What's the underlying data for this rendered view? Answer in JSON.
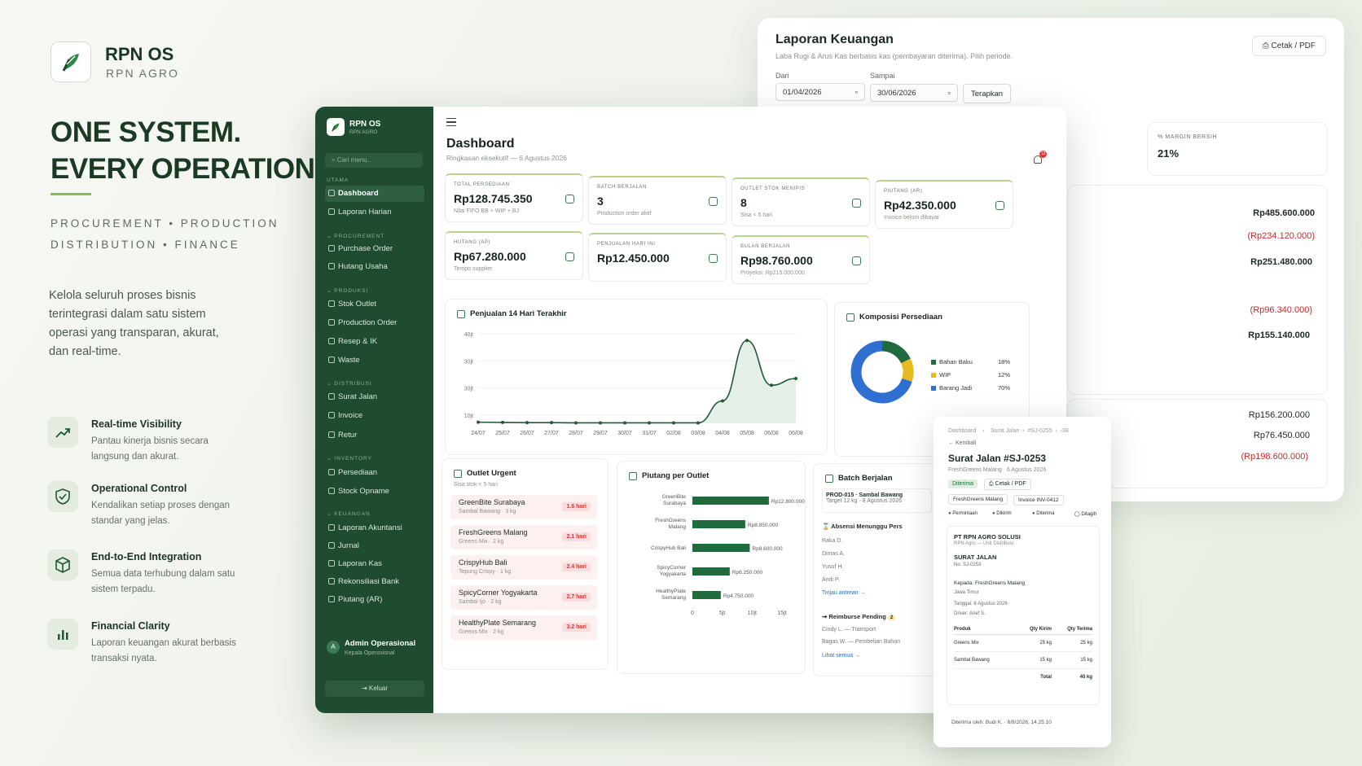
{
  "brand": {
    "name": "RPN OS",
    "sub": "RPN AGRO"
  },
  "hero": {
    "line1": "ONE SYSTEM.",
    "line2": "EVERY OPERATION.",
    "tag1": "PROCUREMENT • PRODUCTION",
    "tag2": "DISTRIBUTION • FINANCE",
    "desc": "Kelola seluruh proses bisnis terintegrasi dalam satu sistem operasi yang transparan, akurat, dan real-time."
  },
  "features": [
    {
      "icon": "trend-up-icon",
      "title": "Real-time Visibility",
      "desc": "Pantau kinerja bisnis secara langsung dan akurat."
    },
    {
      "icon": "shield-check-icon",
      "title": "Operational Control",
      "desc": "Kendalikan setiap proses dengan standar yang jelas."
    },
    {
      "icon": "cube-icon",
      "title": "End-to-End Integration",
      "desc": "Semua data terhubung dalam satu sistem terpadu."
    },
    {
      "icon": "bar-chart-icon",
      "title": "Financial Clarity",
      "desc": "Laporan keuangan akurat berbasis transaksi nyata."
    }
  ],
  "finance": {
    "title": "Laporan Keuangan",
    "sub": "Laba Rugi & Arus Kas berbasis kas (pembayaran diterima). Pilih periode.",
    "print": "Cetak / PDF",
    "from_label": "Dari",
    "to_label": "Sampai",
    "from": "01/04/2026",
    "to": "30/06/2026",
    "apply": "Terapkan",
    "margin_label": "% MARGIN BERSIH",
    "margin": "21%",
    "values": [
      "Rp485.600.000",
      "(Rp234.120.000)",
      "Rp251.480.000",
      "(Rp96.340.000)",
      "Rp155.140.000",
      "Rp156.200.000",
      "Rp76.450.000",
      "(Rp198.600.000)"
    ]
  },
  "sidebar": {
    "name": "RPN OS",
    "sub": "RPN AGRO",
    "search": "Cari menu...",
    "sections": [
      "UTAMA",
      "PROCUREMENT",
      "PRODUKSI",
      "DISTRIBUSI",
      "INVENTORY",
      "KEUANGAN"
    ],
    "items": [
      "Dashboard",
      "Laporan Harian",
      "Purchase Order",
      "Hutang Usaha",
      "Stok Outlet",
      "Production Order",
      "Resep & IK",
      "Waste",
      "Surat Jalan",
      "Invoice",
      "Retur",
      "Persediaan",
      "Stock Opname",
      "Laporan Akuntansi",
      "Jurnal",
      "Laporan Kas",
      "Rekonsiliasi Bank",
      "Piutang (AR)"
    ],
    "user": "Admin Operasional",
    "role": "Kepala Operasional",
    "avatar": "A",
    "logout": "Keluar"
  },
  "dash": {
    "title": "Dashboard",
    "sub": "Ringkasan eksekutif — 6 Agustus 2026",
    "notif": "12"
  },
  "kpis": [
    {
      "label": "TOTAL PERSEDIAAN",
      "value": "Rp128.745.350",
      "sub": "Nilai FIFO BB + WIP + BJ"
    },
    {
      "label": "BATCH BERJALAN",
      "value": "3",
      "sub": "Production order aktif"
    },
    {
      "label": "OUTLET STOK MENIPIS",
      "value": "8",
      "sub": "Sisa < 5 hari"
    },
    {
      "label": "PIUTANG (AR)",
      "value": "Rp42.350.000",
      "sub": "Invoice belum dibayar"
    },
    {
      "label": "HUTANG (AP)",
      "value": "Rp67.280.000",
      "sub": "Tempo supplier"
    },
    {
      "label": "PENJUALAN HARI INI",
      "value": "Rp12.450.000",
      "sub": ""
    },
    {
      "label": "BULAN BERJALAN",
      "value": "Rp98.760.000",
      "sub": "Proyeksi: Rp215.000.000"
    }
  ],
  "sales": {
    "title": "Penjualan 14 Hari Terakhir"
  },
  "chart_data": [
    {
      "type": "area",
      "title": "Penjualan 14 Hari Terakhir",
      "x": [
        "24/07",
        "25/07",
        "26/07",
        "27/07",
        "28/07",
        "29/07",
        "30/07",
        "31/07",
        "02/08",
        "03/08",
        "04/08",
        "05/08",
        "06/08",
        "06/08"
      ],
      "y_ticks": [
        "40jt",
        "30jt",
        "30jt",
        "10jt"
      ],
      "values": [
        0.5,
        0.4,
        0.3,
        0.3,
        0.2,
        0.2,
        0.2,
        0.2,
        0.2,
        0.2,
        10,
        37,
        17,
        20
      ],
      "ylim": [
        0,
        40
      ]
    },
    {
      "type": "pie",
      "title": "Komposisi Persediaan",
      "labels": [
        "Bahan Baku",
        "WIP",
        "Barang Jadi"
      ],
      "values": [
        18,
        12,
        70
      ],
      "display": [
        "18%",
        "12%",
        "70%"
      ],
      "colors": [
        "#1f6b3e",
        "#e8b923",
        "#2f6fd1"
      ]
    },
    {
      "type": "bar",
      "title": "Piutang per Outlet",
      "categories": [
        "GreenBite Surabaya",
        "FreshGreens Malang",
        "CrispyHub Bali",
        "SpicyCorner Yogyakarta",
        "HealthyPlate Semarang"
      ],
      "values": [
        12800000,
        8850000,
        9600000,
        6250000,
        4750000
      ],
      "labels": [
        "Rp12.800.000",
        "Rp8.850.000",
        "Rp9.600.000",
        "Rp6.250.000",
        "Rp4.750.000"
      ],
      "x_ticks": [
        "0",
        "5jt",
        "10jt",
        "15jt"
      ],
      "xlim": [
        0,
        15000000
      ]
    }
  ],
  "urgent": {
    "title": "Outlet Urgent",
    "sub": "Sisa stok < 5 hari",
    "items": [
      {
        "name": "GreenBite Surabaya",
        "meta": "Sambal Bawang · 3 kg",
        "badge": "1.6 hari"
      },
      {
        "name": "FreshGreens Malang",
        "meta": "Greens Mix · 2 kg",
        "badge": "2.1 hari"
      },
      {
        "name": "CrispyHub Bali",
        "meta": "Tepung Crispy · 1 kg",
        "badge": "2.4 hari"
      },
      {
        "name": "SpicyCorner Yogyakarta",
        "meta": "Sambal Ijo · 2 kg",
        "badge": "2.7 hari"
      },
      {
        "name": "HealthyPlate Semarang",
        "meta": "Greens Mix · 2 kg",
        "badge": "3.2 hari"
      }
    ]
  },
  "piutang_title": "Piutang per Outlet",
  "batch": {
    "title": "Batch Berjalan",
    "item": "PROD-015 · Sambal Bawang",
    "meta": "Target 12 kg · 8 Agustus 2026",
    "abs": "Absensi Menunggu Pers",
    "names": [
      "Raka D.",
      "Dimas A.",
      "Yusuf H.",
      "Andi P."
    ],
    "link1": "Tinjau antrean →",
    "reimb": "Reimburse Pending",
    "reimb_n": "2",
    "r1": "Cindy L. — Transport",
    "r2": "Bagas W. — Pembelian Bahan",
    "link2": "Lihat semua →"
  },
  "sj": {
    "bc": "Dashboard    ›    Surat Jalan  ›  #SJ-0255  ›  ‹38",
    "back": "← Kembali",
    "title": "Surat Jalan #SJ-0253",
    "sub": "FreshGreens Malang · 6 Agustus 2026",
    "status": "Diterima",
    "print": "Cetak / PDF",
    "chip1": "FreshGreens Malang",
    "chip2": "Invoice INV-0412",
    "steps": [
      "Permintaan",
      "Dikirim",
      "Diterima",
      "Ditagih"
    ],
    "co": "PT RPN AGRO SOLUSI",
    "co_sub": "RPN Agro — Unit Distribusi",
    "doc": "SURAT JALAN",
    "no": "No. SJ-0253",
    "to": "Kepada: FreshGreens Malang",
    "reg": "Jawa Timur",
    "date": "Tanggal: 6 Agustus 2026",
    "driver": "Driver: Arief S.",
    "th": [
      "Produk",
      "Qty Kirim",
      "Qty Terima"
    ],
    "rows": [
      [
        "Greens Mix",
        "25 kg",
        "25 kg"
      ],
      [
        "Sambal Bawang",
        "15 kg",
        "15 kg"
      ]
    ],
    "total_label": "Total",
    "total": "40 kg",
    "recv": "Diterima oleh: Budi K. · 6/8/2026, 14.25.10"
  }
}
